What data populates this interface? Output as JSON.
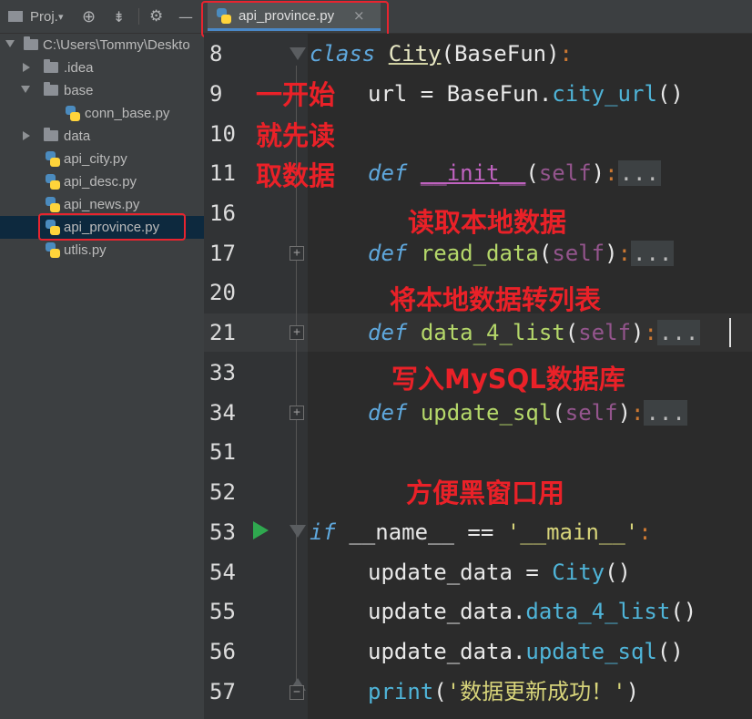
{
  "project_panel": {
    "title": "Proj.",
    "tree": [
      {
        "label": "C:\\Users\\Tommy\\Deskto",
        "type": "folder",
        "expanded": true,
        "depth": 0
      },
      {
        "label": ".idea",
        "type": "folder",
        "expanded": false,
        "depth": 1
      },
      {
        "label": "base",
        "type": "folder",
        "expanded": true,
        "depth": 1
      },
      {
        "label": "conn_base.py",
        "type": "file",
        "depth": 2
      },
      {
        "label": "data",
        "type": "folder",
        "expanded": false,
        "depth": 1
      },
      {
        "label": "api_city.py",
        "type": "file",
        "depth": 1
      },
      {
        "label": "api_desc.py",
        "type": "file",
        "depth": 1
      },
      {
        "label": "api_news.py",
        "type": "file",
        "depth": 1
      },
      {
        "label": "api_province.py",
        "type": "file",
        "depth": 1,
        "selected": true
      },
      {
        "label": "utlis.py",
        "type": "file",
        "depth": 1
      }
    ]
  },
  "editor": {
    "tab": {
      "label": "api_province.py",
      "close": "×"
    },
    "line_numbers": [
      "8",
      "9",
      "10",
      "11",
      "16",
      "17",
      "20",
      "21",
      "33",
      "34",
      "51",
      "52",
      "53",
      "54",
      "55",
      "56",
      "57"
    ],
    "code": {
      "l8_kw": "class",
      "l8_cls": "City",
      "l8_rest": "(BaseFun)",
      "l8_colon": ":",
      "l9_a": "url = BaseFun.",
      "l9_attr": "city_url",
      "l9_b": "()",
      "l11_kw": "def",
      "l11_fn": "__init__",
      "l11_p1": "(",
      "l11_self": "self",
      "l11_p2": ")",
      "l11_colon": ":",
      "l11_fold": "...",
      "l17_kw": "def",
      "l17_fn": "read_data",
      "l17_p1": "(",
      "l17_self": "self",
      "l17_p2": ")",
      "l17_colon": ":",
      "l17_fold": "...",
      "l21_kw": "def",
      "l21_fn": "data_4_list",
      "l21_p1": "(",
      "l21_self": "self",
      "l21_p2": ")",
      "l21_colon": ":",
      "l21_fold": "...",
      "l34_kw": "def",
      "l34_fn": "update_sql",
      "l34_p1": "(",
      "l34_self": "self",
      "l34_p2": ")",
      "l34_colon": ":",
      "l34_fold": "...",
      "l53_kw": "if",
      "l53_a": " __name__ ",
      "l53_op": "==",
      "l53_str": " '__main__'",
      "l53_colon": ":",
      "l54_a": "update_data = ",
      "l54_attr": "City",
      "l54_b": "()",
      "l55_a": "update_data.",
      "l55_attr": "data_4_list",
      "l55_b": "()",
      "l56_a": "update_data.",
      "l56_attr": "update_sql",
      "l56_b": "()",
      "l57_fn": "print",
      "l57_p1": "(",
      "l57_str": "'数据更新成功！'",
      "l57_p2": ")"
    }
  },
  "annotations": {
    "first_read": [
      "一开始",
      "就先读",
      "取数据"
    ],
    "read_local": "读取本地数据",
    "to_list": "将本地数据转列表",
    "write_mysql": "写入MySQL数据库",
    "console": "方便黑窗口用"
  },
  "colors": {
    "annotation": "#ea2128",
    "highlight_box": "#e8242f",
    "selection": "#0d293e",
    "run": "#2fa84f"
  }
}
